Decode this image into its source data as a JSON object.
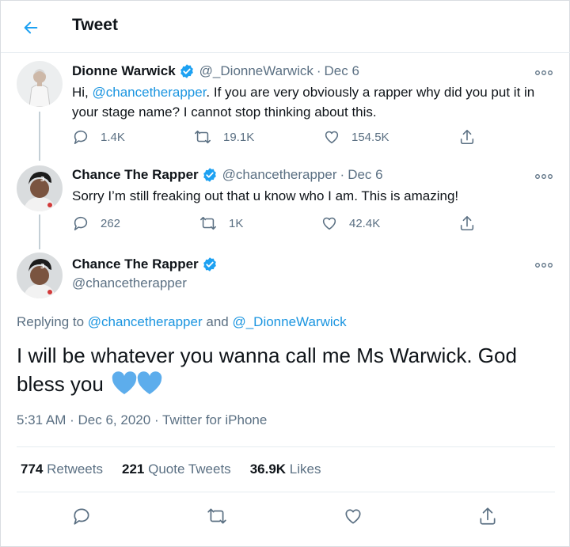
{
  "header": {
    "title": "Tweet"
  },
  "tweets": [
    {
      "name": "Dionne Warwick",
      "handle": "@_DionneWarwick",
      "separator": "·",
      "date": "Dec 6",
      "text_prefix": "Hi, ",
      "mention": "@chancetherapper",
      "text_suffix": ". If you are very obviously a rapper why did you put it in your stage name? I cannot stop thinking about this.",
      "replies": "1.4K",
      "retweets": "19.1K",
      "likes": "154.5K"
    },
    {
      "name": "Chance The Rapper",
      "handle": "@chancetherapper",
      "separator": "·",
      "date": "Dec 6",
      "text": "Sorry I’m still freaking out that u know who I am. This is amazing!",
      "replies": "262",
      "retweets": "1K",
      "likes": "42.4K"
    }
  ],
  "main_tweet": {
    "name": "Chance The Rapper",
    "handle": "@chancetherapper",
    "replying_prefix": "Replying to ",
    "replying_to_1": "@chancetherapper",
    "replying_and": " and ",
    "replying_to_2": "@_DionneWarwick",
    "text": "I will be whatever you wanna call me Ms Warwick. God bless you",
    "time": "5:31 AM",
    "meta_sep": "·",
    "date": "Dec 6, 2020",
    "source": "Twitter for iPhone",
    "stats": {
      "retweets_count": "774",
      "retweets_label": "Retweets",
      "quotes_count": "221",
      "quotes_label": "Quote Tweets",
      "likes_count": "36.9K",
      "likes_label": "Likes"
    }
  },
  "colors": {
    "accent": "#1da1f2",
    "link": "#1b95e0",
    "muted": "#5b7083",
    "heart_emoji": "#5dadec"
  },
  "icons": {
    "back": "arrow-left-icon",
    "verified": "verified-badge-icon",
    "more": "more-dots-icon",
    "reply": "reply-icon",
    "retweet": "retweet-icon",
    "like": "heart-icon",
    "share": "share-icon",
    "emoji": "blue-heart-emoji"
  }
}
